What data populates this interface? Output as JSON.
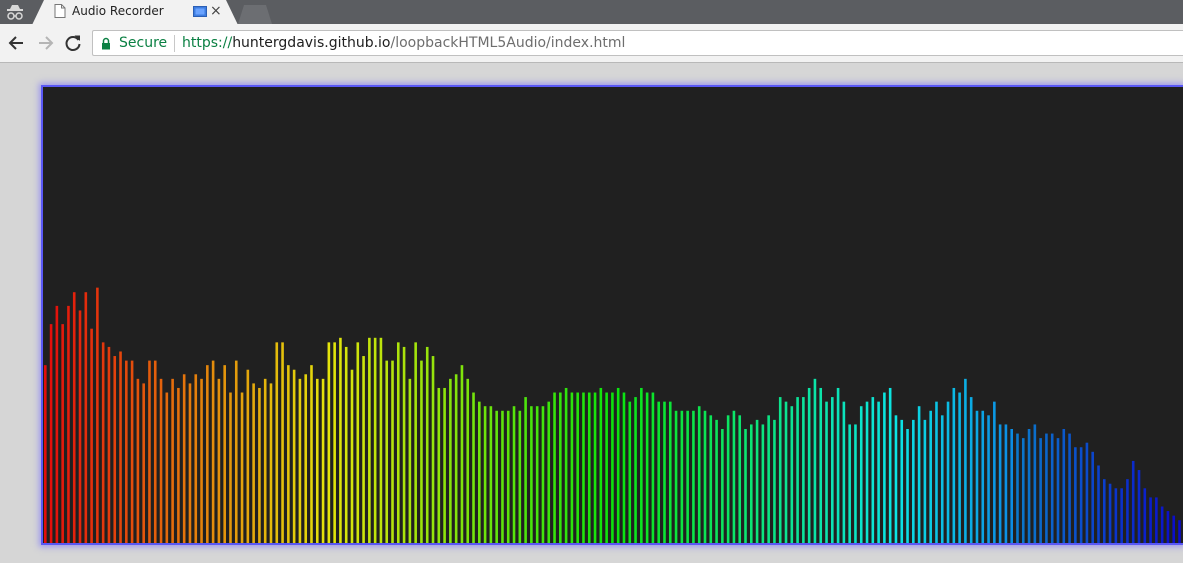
{
  "tab": {
    "title": "Audio Recorder",
    "close_glyph": "×",
    "icon": "page-icon",
    "media_icon": "media-casting-icon"
  },
  "nav": {
    "back_icon": "back-arrow-icon",
    "forward_icon": "forward-arrow-icon",
    "reload_icon": "reload-icon"
  },
  "omnibox": {
    "security_label": "Secure",
    "url_scheme": "https://",
    "url_host": "huntergdavis.github.io",
    "url_path": "/loopbackHTML5Audio/index.html"
  },
  "colors": {
    "canvas_background": "#202020",
    "canvas_border": "#5a58f5",
    "secure_green": "#0b8043"
  },
  "visualizer": {
    "type": "frequency-bars",
    "bar_count": 195,
    "color_ramp": "red → orange → yellow → green → cyan → blue",
    "levels": [
      0.39,
      0.48,
      0.52,
      0.48,
      0.52,
      0.55,
      0.51,
      0.55,
      0.47,
      0.56,
      0.44,
      0.43,
      0.41,
      0.42,
      0.4,
      0.4,
      0.36,
      0.35,
      0.4,
      0.4,
      0.36,
      0.33,
      0.36,
      0.34,
      0.37,
      0.35,
      0.37,
      0.36,
      0.39,
      0.4,
      0.36,
      0.39,
      0.33,
      0.4,
      0.33,
      0.38,
      0.35,
      0.34,
      0.36,
      0.35,
      0.44,
      0.44,
      0.39,
      0.38,
      0.36,
      0.37,
      0.39,
      0.36,
      0.36,
      0.44,
      0.44,
      0.45,
      0.43,
      0.38,
      0.44,
      0.41,
      0.45,
      0.45,
      0.45,
      0.4,
      0.4,
      0.44,
      0.43,
      0.36,
      0.44,
      0.4,
      0.43,
      0.41,
      0.34,
      0.34,
      0.36,
      0.37,
      0.39,
      0.36,
      0.33,
      0.31,
      0.3,
      0.3,
      0.29,
      0.29,
      0.29,
      0.3,
      0.29,
      0.32,
      0.3,
      0.3,
      0.3,
      0.31,
      0.33,
      0.33,
      0.34,
      0.33,
      0.33,
      0.33,
      0.33,
      0.33,
      0.34,
      0.33,
      0.33,
      0.34,
      0.33,
      0.31,
      0.32,
      0.34,
      0.33,
      0.33,
      0.31,
      0.31,
      0.31,
      0.29,
      0.29,
      0.29,
      0.29,
      0.3,
      0.29,
      0.28,
      0.27,
      0.25,
      0.28,
      0.29,
      0.28,
      0.25,
      0.26,
      0.27,
      0.26,
      0.28,
      0.27,
      0.32,
      0.31,
      0.3,
      0.32,
      0.32,
      0.34,
      0.36,
      0.34,
      0.31,
      0.32,
      0.34,
      0.31,
      0.26,
      0.26,
      0.3,
      0.31,
      0.32,
      0.31,
      0.33,
      0.34,
      0.28,
      0.27,
      0.25,
      0.27,
      0.3,
      0.27,
      0.29,
      0.31,
      0.28,
      0.31,
      0.34,
      0.33,
      0.36,
      0.32,
      0.29,
      0.29,
      0.28,
      0.31,
      0.26,
      0.26,
      0.25,
      0.24,
      0.23,
      0.25,
      0.26,
      0.23,
      0.24,
      0.24,
      0.23,
      0.25,
      0.24,
      0.21,
      0.21,
      0.22,
      0.2,
      0.17,
      0.14,
      0.13,
      0.12,
      0.12,
      0.14,
      0.18,
      0.16,
      0.12,
      0.1,
      0.1,
      0.08,
      0.07,
      0.06,
      0.05
    ]
  }
}
